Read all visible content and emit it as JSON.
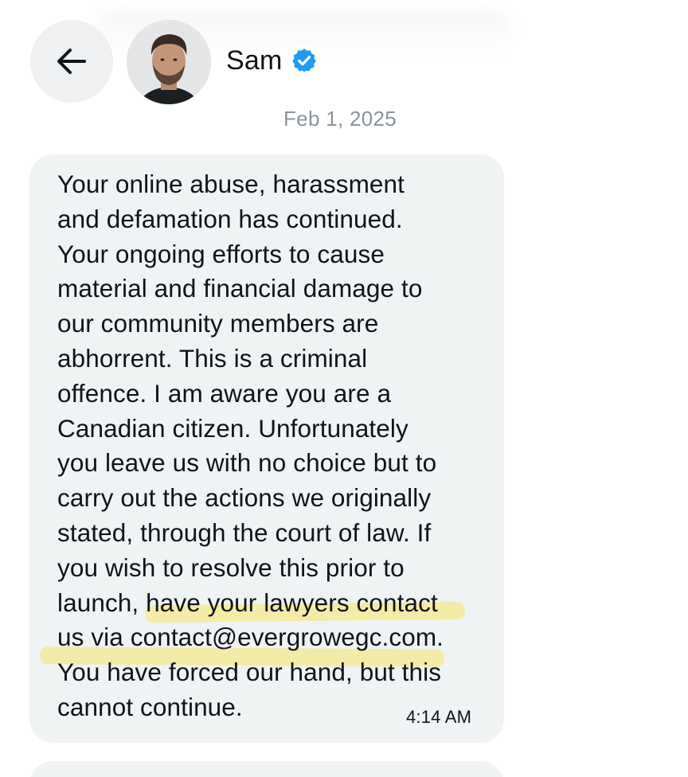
{
  "header": {
    "back_icon": "arrow-left-icon",
    "contact_name": "Sam",
    "verified_icon": "verified-badge-icon",
    "avatar_icon": "user-avatar"
  },
  "conversation": {
    "date_separator": "Feb 1, 2025",
    "messages": [
      {
        "text": "Your online abuse, harassment\nand defamation has continued.\nYour ongoing efforts to cause\nmaterial and financial damage to\nour community members are\nabhorrent. This is a criminal\noffence. I am aware you are a\nCanadian citizen. Unfortunately\nyou leave us with no choice but to\ncarry out the actions we originally\nstated, through the court of law. If\nyou wish to resolve this prior to\nlaunch, have your lawyers contact\nus via contact@evergrowegc.com.\nYou have forced our hand, but this\ncannot continue.",
        "time": "4:14 AM"
      }
    ]
  },
  "colors": {
    "bubble_bg": "#eff3f4",
    "verified_blue": "#1d9bf0",
    "date_gray": "#8a939c",
    "highlight": "#f6e67c"
  }
}
